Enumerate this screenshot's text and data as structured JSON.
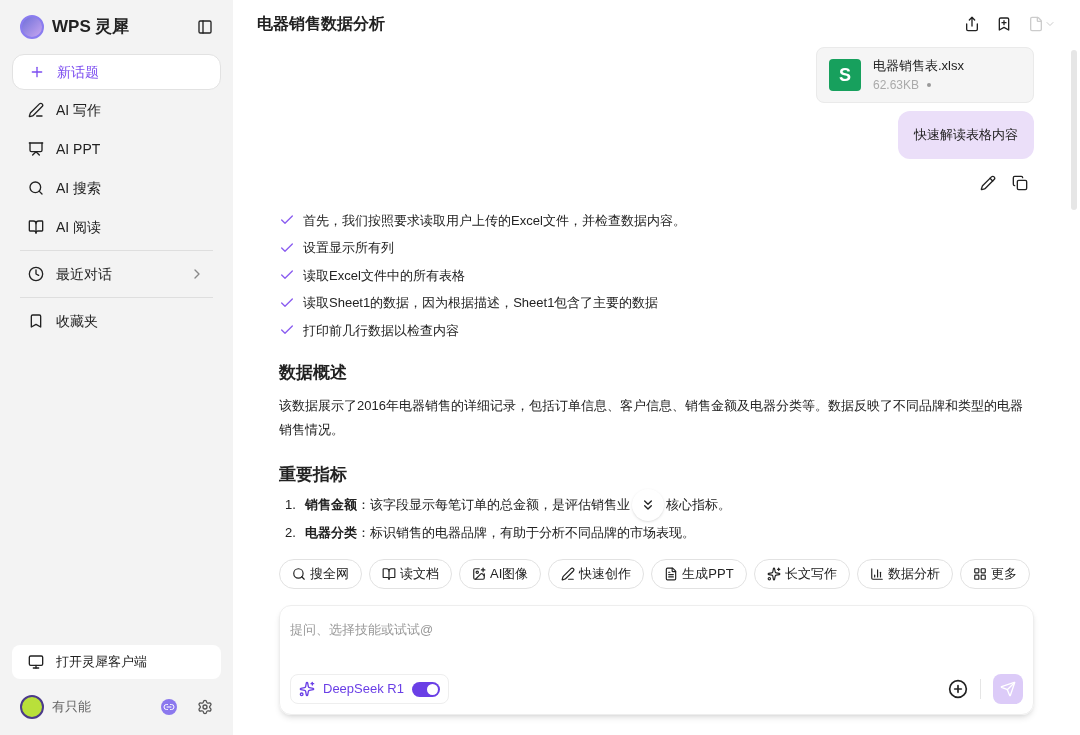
{
  "sidebar": {
    "brand": "WPS 灵犀",
    "new_topic": "新话题",
    "items": [
      {
        "kind": "write",
        "label": "AI 写作"
      },
      {
        "kind": "ppt",
        "label": "AI PPT"
      },
      {
        "kind": "search",
        "label": "AI 搜索"
      },
      {
        "kind": "read",
        "label": "AI 阅读"
      }
    ],
    "recent": "最近对话",
    "favorites": "收藏夹",
    "open_client": "打开灵犀客户端",
    "user": "有只能"
  },
  "title": "电器销售数据分析",
  "file": {
    "name": "电器销售表.xlsx",
    "icon_letter": "S",
    "size": "62.63KB"
  },
  "user_message": "快速解读表格内容",
  "steps": [
    "首先，我们按照要求读取用户上传的Excel文件，并检查数据内容。",
    "设置显示所有列",
    "读取Excel文件中的所有表格",
    "读取Sheet1的数据，因为根据描述，Sheet1包含了主要的数据",
    "打印前几行数据以检查内容"
  ],
  "sections": [
    {
      "heading": "数据概述",
      "paragraph": "该数据展示了2016年电器销售的详细记录，包括订单信息、客户信息、销售金额及电器分类等。数据反映了不同品牌和类型的电器销售情况。"
    },
    {
      "heading": "重要指标",
      "list": [
        {
          "number": "1.",
          "segments": [
            "**销售金额**：该字段显示每笔订单的总金额，是评估销售业",
            "核心指标。"
          ]
        },
        {
          "number": "2.",
          "segments": [
            "**电器分类**：标识销售的电器品牌，有助于分析不同品牌的市场表现。"
          ]
        }
      ]
    }
  ],
  "skills": [
    {
      "kind": "search",
      "label": "搜全网"
    },
    {
      "kind": "doc",
      "label": "读文档"
    },
    {
      "kind": "image",
      "label": "AI图像"
    },
    {
      "kind": "create",
      "label": "快速创作"
    },
    {
      "kind": "ppt",
      "label": "生成PPT"
    },
    {
      "kind": "long",
      "label": "长文写作"
    },
    {
      "kind": "data",
      "label": "数据分析"
    },
    {
      "kind": "more",
      "label": "更多"
    }
  ],
  "input": {
    "placeholder": "提问、选择技能或试试@"
  },
  "model": {
    "name": "DeepSeek R1",
    "on": true
  }
}
